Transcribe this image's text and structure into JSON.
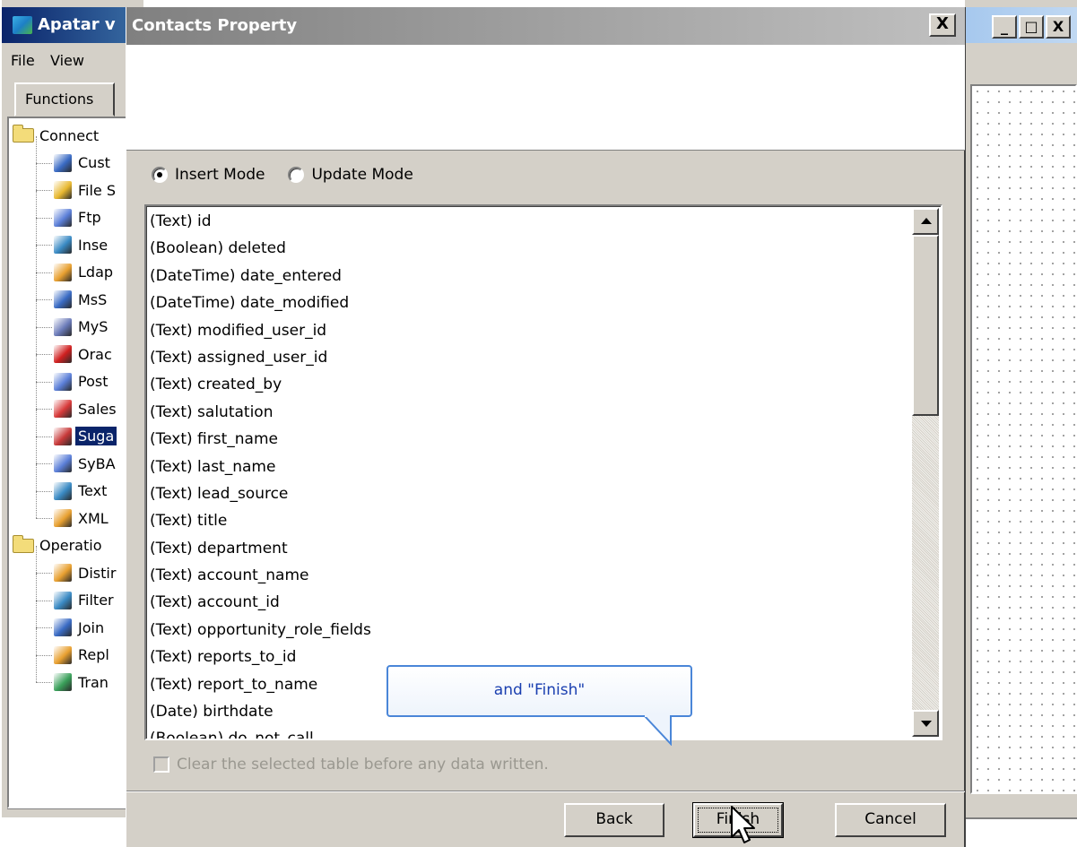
{
  "main_window": {
    "title": "Apatar v",
    "menu": [
      "File",
      "View"
    ],
    "functions_tab": "Functions",
    "tree": [
      {
        "label": "Connect",
        "type": "folder",
        "level": 0
      },
      {
        "label": "Cust",
        "level": 1,
        "icon": "database-icon",
        "color": "#3a6bc4"
      },
      {
        "label": "File S",
        "level": 1,
        "icon": "file-icon",
        "color": "#e8b830"
      },
      {
        "label": "Ftp",
        "level": 1,
        "icon": "ftp-icon",
        "color": "#5b7fd8"
      },
      {
        "label": "Inse",
        "level": 1,
        "icon": "insert-icon",
        "color": "#3a8ac4"
      },
      {
        "label": "Ldap",
        "level": 1,
        "icon": "ldap-icon",
        "color": "#e8a030"
      },
      {
        "label": "MsS",
        "level": 1,
        "icon": "mssql-icon",
        "color": "#3a6bc4"
      },
      {
        "label": "MyS",
        "level": 1,
        "icon": "mysql-icon",
        "color": "#6a7ab8"
      },
      {
        "label": "Orac",
        "level": 1,
        "icon": "oracle-icon",
        "color": "#d02020"
      },
      {
        "label": "Post",
        "level": 1,
        "icon": "postgres-icon",
        "color": "#5b7fd8"
      },
      {
        "label": "Sales",
        "level": 1,
        "icon": "salesforce-icon",
        "color": "#d83a3a"
      },
      {
        "label": "Suga",
        "level": 1,
        "icon": "sugarcrm-icon",
        "color": "#c83a3a",
        "selected": true
      },
      {
        "label": "SyBA",
        "level": 1,
        "icon": "sybase-icon",
        "color": "#5b7fd8"
      },
      {
        "label": "Text",
        "level": 1,
        "icon": "text-file-icon",
        "color": "#3a8ac4"
      },
      {
        "label": "XML",
        "level": 1,
        "icon": "xml-icon",
        "color": "#e8a030"
      },
      {
        "label": "Operatio",
        "type": "folder",
        "level": 0
      },
      {
        "label": "Distir",
        "level": 1,
        "icon": "distinct-icon",
        "color": "#e8a030"
      },
      {
        "label": "Filter",
        "level": 1,
        "icon": "filter-icon",
        "color": "#3a8ac4"
      },
      {
        "label": "Join",
        "level": 1,
        "icon": "join-icon",
        "color": "#3a6bc4"
      },
      {
        "label": "Repl",
        "level": 1,
        "icon": "replace-icon",
        "color": "#e8a030"
      },
      {
        "label": "Tran",
        "level": 1,
        "icon": "transform-icon",
        "color": "#3aa05a"
      }
    ]
  },
  "dialog": {
    "title": "Contacts Property",
    "close_glyph": "X",
    "insert_mode_label": "Insert Mode",
    "update_mode_label": "Update Mode",
    "selected_mode": "insert",
    "fields": [
      "(Text) id",
      "(Boolean) deleted",
      "(DateTime) date_entered",
      "(DateTime) date_modified",
      "(Text) modified_user_id",
      "(Text) assigned_user_id",
      "(Text) created_by",
      "(Text) salutation",
      "(Text) first_name",
      "(Text) last_name",
      "(Text) lead_source",
      "(Text) title",
      "(Text) department",
      "(Text) account_name",
      "(Text) account_id",
      "(Text) opportunity_role_fields",
      "(Text) reports_to_id",
      "(Text) report_to_name",
      "(Date) birthdate",
      "(Boolean) do_not_call"
    ],
    "clear_table_label": "Clear the selected table before any data written.",
    "clear_table_checked": false,
    "back_label": "Back",
    "finish_label": "Finish",
    "cancel_label": "Cancel"
  },
  "callout": {
    "text": "and \"Finish\""
  },
  "right_window": {
    "minimize_glyph": "_",
    "maximize_glyph": "□",
    "close_glyph": "X"
  }
}
